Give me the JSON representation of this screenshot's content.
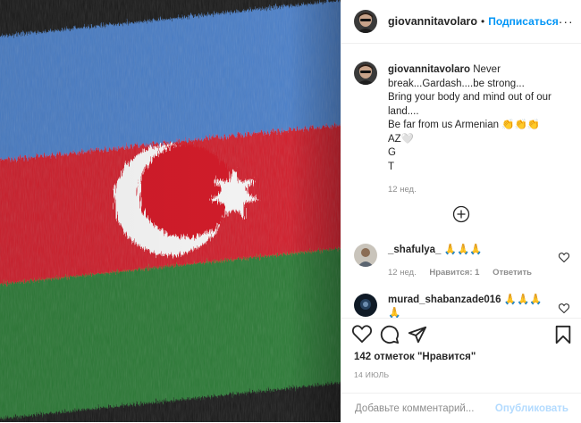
{
  "post": {
    "author": "giovannitavolaro",
    "separator": "•",
    "follow_label": "Подписаться",
    "more_label": "···",
    "caption": {
      "username": "giovannitavolaro",
      "line1": " Never break...Gardash....be strong...",
      "line2": "Bring your body and mind out of our land....",
      "line3": "Be far from us Armenian 👏👏👏",
      "line4": "AZ🤍",
      "line5": "G",
      "line6": "T",
      "time": "12 нед."
    },
    "comments": [
      {
        "username": "_shafulya_",
        "text": " 🙏🙏🙏",
        "time": "12 нед.",
        "likes": "Нравится: 1",
        "reply": "Ответить"
      },
      {
        "username": "murad_shabanzade016",
        "text": " 🙏🙏🙏 🙏"
      }
    ],
    "likes_text": "142 отметок \"Нравится\"",
    "date": "14 ИЮЛЬ",
    "add_comment_placeholder": "Добавьте комментарий...",
    "publish_label": "Опубликовать"
  },
  "icons": {
    "like": "heart-icon",
    "comment": "comment-icon",
    "share": "share-icon",
    "save": "bookmark-icon",
    "load_more": "plus-circle-icon"
  },
  "colors": {
    "flag_blue": "#4a7ec8",
    "flag_red": "#d11f2a",
    "flag_green": "#2c7a36",
    "link_blue": "#0095f6",
    "muted": "#8e8e8e"
  }
}
